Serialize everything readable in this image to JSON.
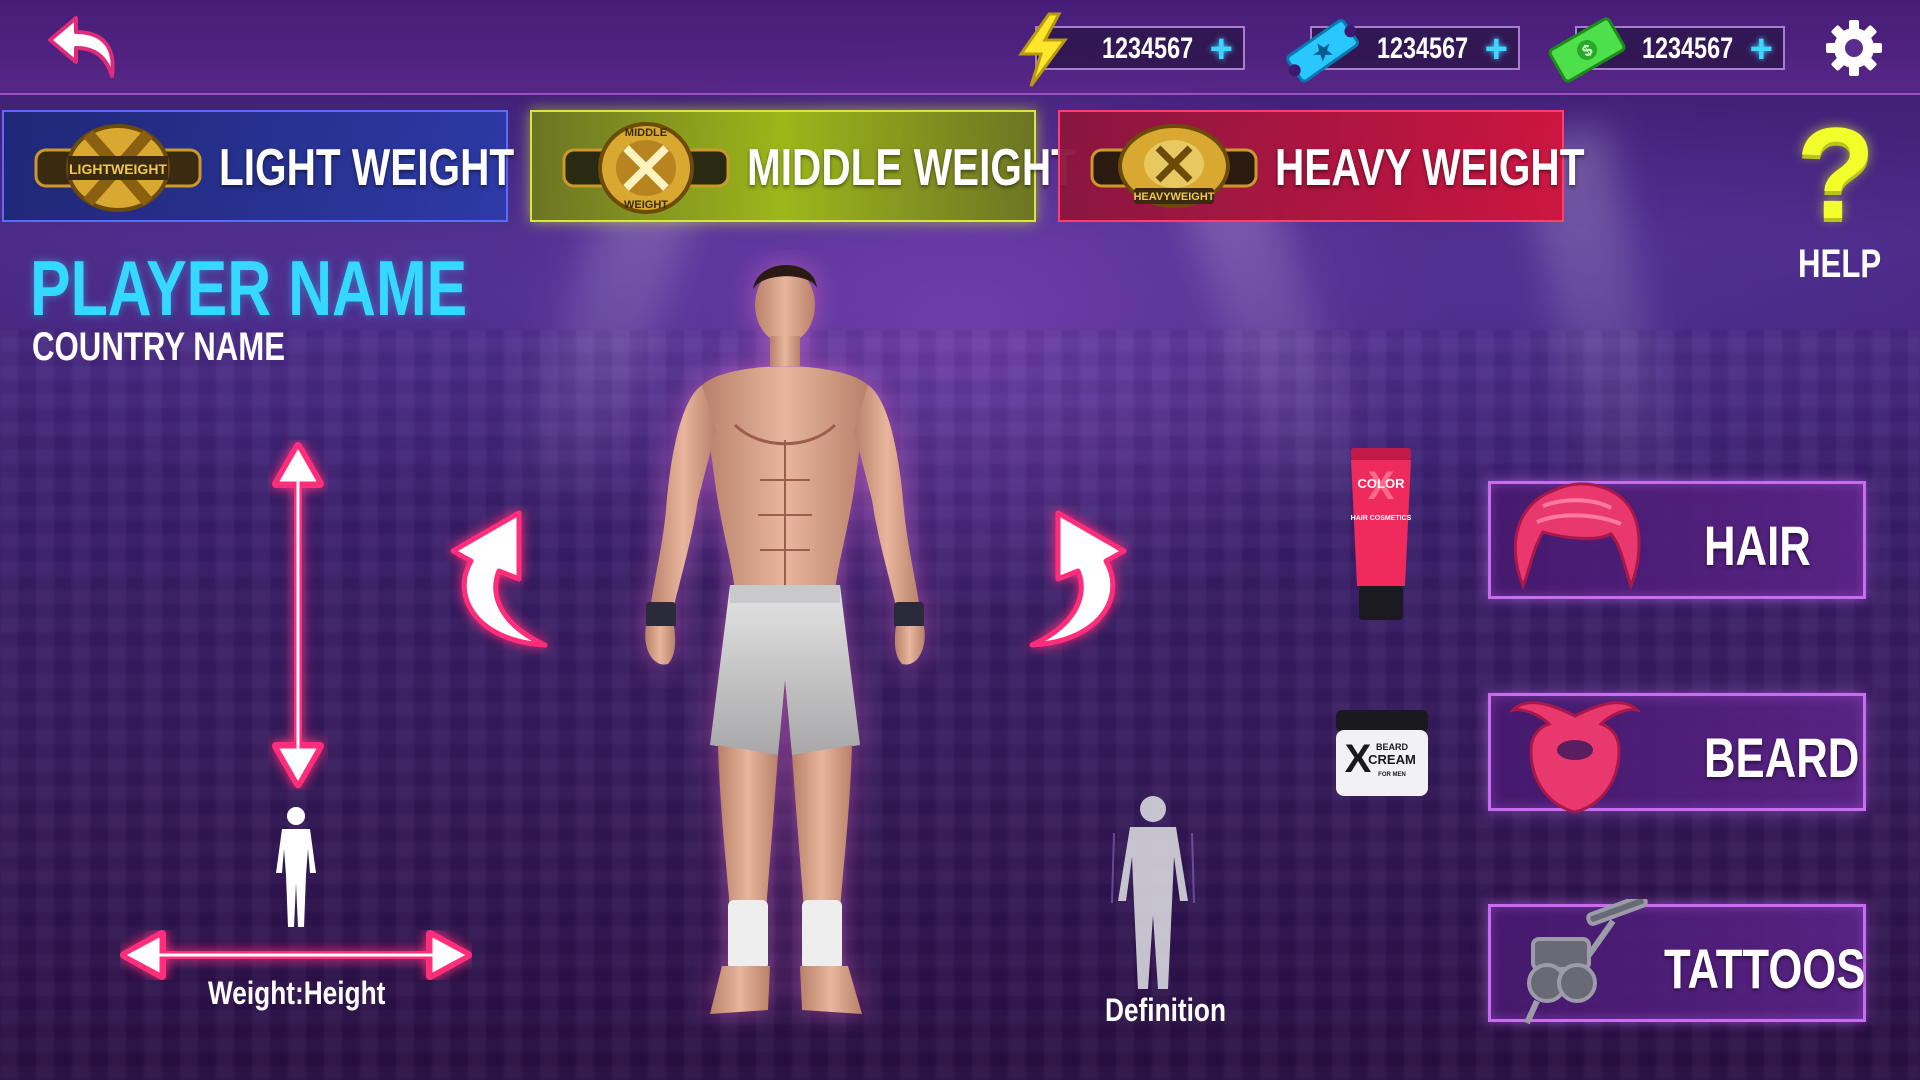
{
  "topbar": {
    "energy": {
      "icon": "lightning-bolt-icon",
      "value": "1234567",
      "add": "+"
    },
    "tickets": {
      "icon": "ticket-icon",
      "value": "1234567",
      "add": "+"
    },
    "cash": {
      "icon": "cash-icon",
      "value": "1234567",
      "add": "+"
    },
    "settings_icon": "gear-icon",
    "back_icon": "back-arrow-icon"
  },
  "weight_classes": [
    {
      "label": "LIGHT WEIGHT",
      "belt_text": "LIGHTWEIGHT",
      "color": "#2f45c8"
    },
    {
      "label": "MIDDLE WEIGHT",
      "belt_text": "MIDDLE WEIGHT",
      "color": "#b5d11e",
      "selected": true
    },
    {
      "label": "HEAVY WEIGHT",
      "belt_text": "HEAVYWEIGHT",
      "color": "#d51a4a"
    }
  ],
  "help": {
    "symbol": "?",
    "label": "HELP"
  },
  "player": {
    "name": "PLAYER NAME",
    "country": "COUNTRY NAME"
  },
  "controls": {
    "weight_height_label": "Weight:Height",
    "definition_label": "Definition"
  },
  "products": {
    "hair_tube": {
      "brand": "COLOR",
      "sub": "HAIR COSMETICS",
      "mark": "X"
    },
    "beard_cream": {
      "line1": "BEARD",
      "line2": "CREAM",
      "line3": "FOR MEN",
      "mark": "X"
    }
  },
  "customize": [
    {
      "label": "HAIR",
      "icon": "hair-icon"
    },
    {
      "label": "BEARD",
      "icon": "beard-icon"
    },
    {
      "label": "TATTOOS",
      "icon": "tattoo-machine-icon"
    }
  ],
  "colors": {
    "accent_cyan": "#35d8ff",
    "accent_pink": "#ff2d7a",
    "accent_purple": "#c86cf0",
    "help_yellow": "#f2ff2a"
  }
}
